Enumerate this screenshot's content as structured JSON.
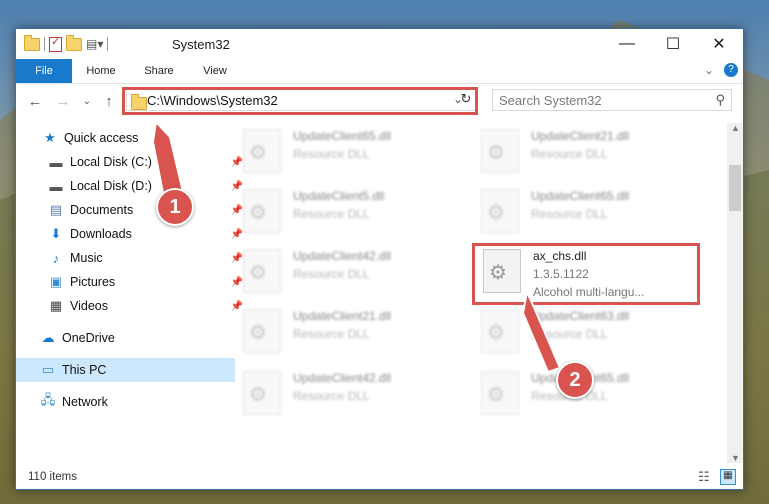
{
  "window": {
    "title": "System32"
  },
  "ribbon": {
    "tabs": [
      "File",
      "Home",
      "Share",
      "View"
    ]
  },
  "address": {
    "path": "C:\\Windows\\System32",
    "search_placeholder": "Search System32"
  },
  "sidebar": {
    "items": [
      {
        "label": "Quick access",
        "icon": "star-icon"
      },
      {
        "label": "Local Disk (C:)",
        "icon": "drive-icon",
        "pinned": true
      },
      {
        "label": "Local Disk (D:)",
        "icon": "drive-icon",
        "pinned": true
      },
      {
        "label": "Documents",
        "icon": "documents-icon",
        "pinned": true
      },
      {
        "label": "Downloads",
        "icon": "download-icon",
        "pinned": true
      },
      {
        "label": "Music",
        "icon": "music-icon",
        "pinned": true
      },
      {
        "label": "Pictures",
        "icon": "pictures-icon",
        "pinned": true
      },
      {
        "label": "Videos",
        "icon": "videos-icon",
        "pinned": true
      },
      {
        "label": "OneDrive",
        "icon": "cloud-icon"
      },
      {
        "label": "This PC",
        "icon": "computer-icon",
        "selected": true
      },
      {
        "label": "Network",
        "icon": "network-icon"
      }
    ]
  },
  "files": [
    {
      "name": "UpdateClient65.dll",
      "type": "Resource DLL"
    },
    {
      "name": "UpdateClient21.dll",
      "type": "Resource DLL"
    },
    {
      "name": "UpdateClient5.dll",
      "type": "Resource DLL"
    },
    {
      "name": "UpdateClient65.dll",
      "type": "Resource DLL"
    },
    {
      "name": "UpdateClient42.dll",
      "type": "Resource DLL"
    },
    {
      "name": "ax_chs.dll",
      "version": "1.3.5.1122",
      "type": "Alcohol multi-langu..."
    },
    {
      "name": "UpdateClient21.dll",
      "type": "Resource DLL"
    },
    {
      "name": "UpdateClient63.dll",
      "type": "Resource DLL"
    },
    {
      "name": "UpdateClient42.dll",
      "type": "Resource DLL"
    },
    {
      "name": "UpdateClient65.dll",
      "type": "Resource DLL"
    }
  ],
  "status": {
    "item_count": "110 items"
  },
  "annotations": {
    "badge1": "1",
    "badge2": "2",
    "color": "#d9534f"
  }
}
